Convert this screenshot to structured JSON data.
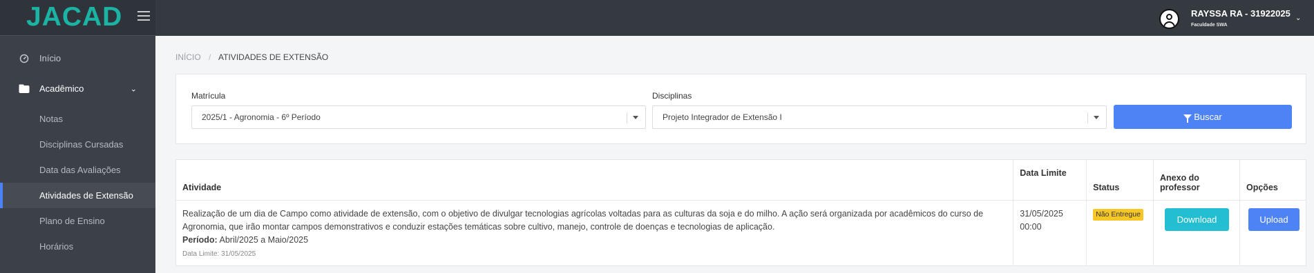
{
  "app": {
    "logo_text": "JACAD"
  },
  "sidebar": {
    "items": [
      {
        "label": "Início",
        "icon": "dashboard-icon"
      },
      {
        "label": "Acadêmico",
        "icon": "folder-icon"
      }
    ],
    "sub_items": [
      {
        "label": "Notas",
        "active": false
      },
      {
        "label": "Disciplinas Cursadas",
        "active": false
      },
      {
        "label": "Data das Avaliações",
        "active": false
      },
      {
        "label": "Atividades de Extensão",
        "active": true
      },
      {
        "label": "Plano de Ensino",
        "active": false
      },
      {
        "label": "Horários",
        "active": false
      }
    ]
  },
  "header": {
    "user_name": "RAYSSA RA - 31922025",
    "user_org": "Faculdade SWA"
  },
  "breadcrumb": {
    "home": "INÍCIO",
    "separator": "/",
    "current": "ATIVIDADES DE EXTENSÃO"
  },
  "filters": {
    "matricula_label": "Matrícula",
    "matricula_value": "2025/1 - Agronomia - 6º Período",
    "disciplinas_label": "Disciplinas",
    "disciplinas_value": "Projeto Integrador de Extensão I",
    "search_label": "Buscar"
  },
  "table": {
    "headers": {
      "atividade": "Atividade",
      "data_limite": "Data Limite",
      "status": "Status",
      "anexo_line1": "Anexo do",
      "anexo_line2": "professor",
      "opcoes": "Opções"
    },
    "rows": [
      {
        "desc_line1": "Realização de um dia de Campo como atividade de extensão, com o objetivo de divulgar tecnologias agrícolas voltadas para as culturas da soja e do milho. A ação será organizada por acadêmicos do curso de",
        "desc_line2": "Agronomia, que irão montar campos demonstrativos e conduzir estações temáticas sobre cultivo, manejo, controle de doenças e tecnologias de aplicação.",
        "periodo_label": "Período:",
        "periodo_value": " Abril/2025 a Maio/2025",
        "data_limite_small": "Data Limite: 31/05/2025",
        "date": "31/05/2025",
        "time": "00:00",
        "status": "Não Entregue",
        "download_label": "Download",
        "upload_label": "Upload"
      }
    ]
  },
  "colors": {
    "sidebar_bg": "#3b4049",
    "topbar_bg": "#353a41",
    "brand_teal": "#1bb3a3",
    "primary_blue": "#4d83f4",
    "download_cyan": "#23bed1",
    "status_yellow": "#f7c728"
  }
}
